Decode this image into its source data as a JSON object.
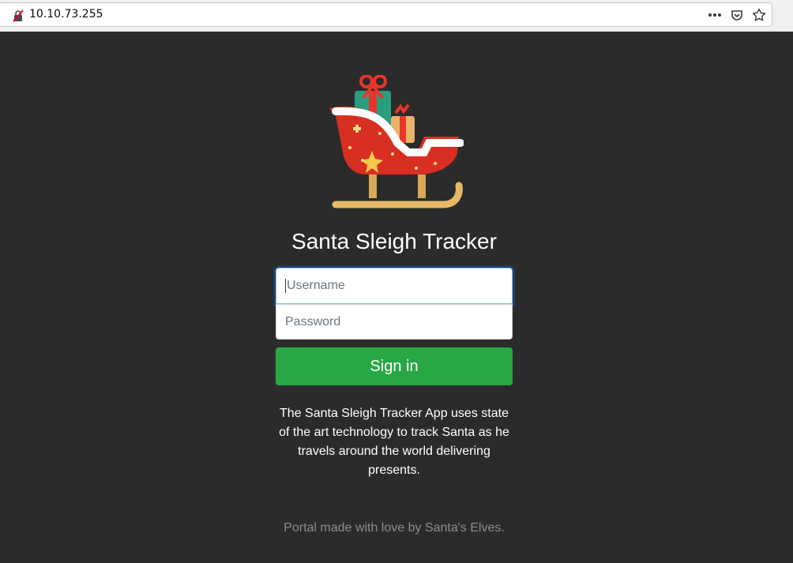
{
  "browser": {
    "url": "10.10.73.255",
    "icons": [
      "insecure-lock-icon",
      "more-actions-icon",
      "pocket-icon",
      "bookmark-star-icon"
    ]
  },
  "page": {
    "logo": "sleigh-logo",
    "title": "Santa Sleigh Tracker",
    "username_placeholder": "Username",
    "password_placeholder": "Password",
    "signin_label": "Sign in",
    "description": "The Santa Sleigh Tracker App uses state of the art technology to track Santa as he travels around the world delivering presents.",
    "footer": "Portal made with love by Santa's Elves."
  },
  "colors": {
    "background": "#2b2b2b",
    "button": "#28a745",
    "footer_text": "#888c91"
  }
}
